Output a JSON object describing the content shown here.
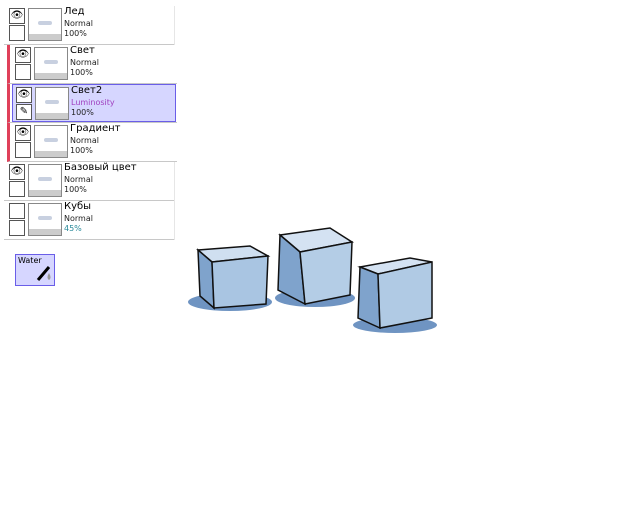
{
  "layers": [
    {
      "name": "Лед",
      "mode": "Normal",
      "opacity": "100%",
      "visible": true,
      "clipped": false,
      "selected": false
    },
    {
      "name": "Свет",
      "mode": "Normal",
      "opacity": "100%",
      "visible": true,
      "clipped": true,
      "selected": false
    },
    {
      "name": "Свет2",
      "mode": "Luminosity",
      "opacity": "100%",
      "visible": true,
      "clipped": true,
      "selected": true
    },
    {
      "name": "Градиент",
      "mode": "Normal",
      "opacity": "100%",
      "visible": true,
      "clipped": true,
      "selected": false
    },
    {
      "name": "Базовый цвет",
      "mode": "Normal",
      "opacity": "100%",
      "visible": true,
      "clipped": false,
      "selected": false
    },
    {
      "name": "Кубы",
      "mode": "Normal",
      "opacity": "45%",
      "visible": false,
      "clipped": false,
      "selected": false
    }
  ],
  "tool": {
    "label": "Water",
    "icon": "water-dropper-icon"
  },
  "colors": {
    "selection": "#d6d6ff",
    "clip_marker": "#e0405a",
    "luminosity_text": "#a040c0",
    "ice": "#a8c4e0",
    "shadow": "#5a86b8"
  }
}
